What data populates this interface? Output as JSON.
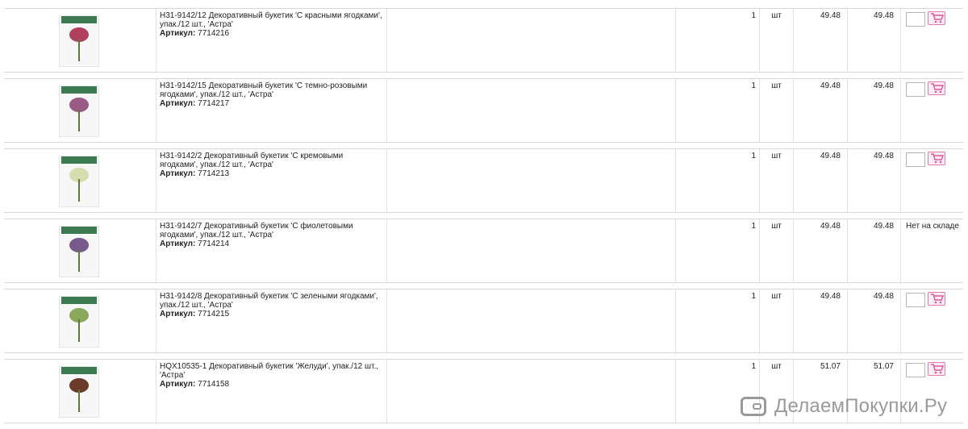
{
  "rows": [
    {
      "name": "H31-9142/12 Декоративный букетик 'С красными ягодками', упак./12 шт., 'Астра'",
      "article_label": "Артикул:",
      "article": "7714216",
      "qty": "1",
      "unit": "шт",
      "price": "49.48",
      "total": "49.48",
      "status": "",
      "berry_color": "#b0405e"
    },
    {
      "name": "H31-9142/15 Декоративный букетик 'С темно-розовыми ягодками', упак./12 шт., 'Астра'",
      "article_label": "Артикул:",
      "article": "7714217",
      "qty": "1",
      "unit": "шт",
      "price": "49.48",
      "total": "49.48",
      "status": "",
      "berry_color": "#9a5a86"
    },
    {
      "name": "H31-9142/2 Декоративный букетик 'С кремовыми ягодками', упак./12 шт., 'Астра'",
      "article_label": "Артикул:",
      "article": "7714213",
      "qty": "1",
      "unit": "шт",
      "price": "49.48",
      "total": "49.48",
      "status": "",
      "berry_color": "#d8ddb0"
    },
    {
      "name": "H31-9142/7 Декоративный букетик 'С фиолетовыми ягодками', упак./12 шт., 'Астра'",
      "article_label": "Артикул:",
      "article": "7714214",
      "qty": "1",
      "unit": "шт",
      "price": "49.48",
      "total": "49.48",
      "status": "Нет на складе",
      "berry_color": "#7a5a8c"
    },
    {
      "name": "H31-9142/8 Декоративный букетик 'С зелеными ягодками', упак./12 шт., 'Астра'",
      "article_label": "Артикул:",
      "article": "7714215",
      "qty": "1",
      "unit": "шт",
      "price": "49.48",
      "total": "49.48",
      "status": "",
      "berry_color": "#8aa85a"
    },
    {
      "name": "HQX10535-1 Декоративный букетик 'Желуди', упак./12 шт., 'Астра'",
      "article_label": "Артикул:",
      "article": "7714158",
      "qty": "1",
      "unit": "шт",
      "price": "51.07",
      "total": "51.07",
      "status": "",
      "berry_color": "#6a3a2a"
    }
  ],
  "watermark": {
    "text": "ДелаемПокупки.Ру"
  },
  "icons": {
    "cart": "cart-icon",
    "watermark": "wallet-logo-icon"
  },
  "colors": {
    "cart_accent": "#e07ab0",
    "tag_green": "#3c7a52"
  }
}
